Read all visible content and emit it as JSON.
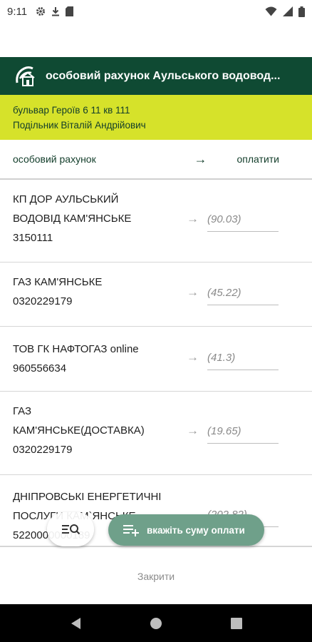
{
  "status_bar": {
    "time": "9:11"
  },
  "header": {
    "title": "особовий рахунок Аульського водовод..."
  },
  "account": {
    "address": "бульвар Героїв 6 11 кв 111",
    "owner": "Подільник Віталій Андрійович"
  },
  "subheader": {
    "left": "особовий рахунок",
    "arrow": "→",
    "right": "оплатити"
  },
  "rows": [
    {
      "lines": [
        "КП ДОР АУЛЬСЬКИЙ",
        "ВОДОВІД КАМ'ЯНСЬКЕ",
        "3150111"
      ],
      "amount": "(90.03)"
    },
    {
      "lines": [
        "ГАЗ КАМ'ЯНСЬКЕ",
        "0320229179"
      ],
      "amount": "(45.22)"
    },
    {
      "lines": [
        "ТОВ ГК НАФТОГАЗ online",
        "960556634"
      ],
      "amount": "(41.3)"
    },
    {
      "lines": [
        "ГАЗ",
        "КАМ'ЯНСЬКЕ(ДОСТАВКА)",
        "0320229179"
      ],
      "amount": "(19.65)"
    },
    {
      "lines": [
        "ДНІПРОВСЬКІ ЕНЕРГЕТИЧНІ",
        "ПОСЛУГИ КАМ`ЯНСЬКЕ",
        "5220000000189"
      ],
      "amount": "(202.82)"
    }
  ],
  "row_arrow": "→",
  "fab": {
    "pay_label": "вкажіть суму оплати"
  },
  "close_label": "Закрити",
  "colors": {
    "header": "#0f4a33",
    "account_bar": "#d6e22a",
    "fab": "#6fa08a"
  }
}
